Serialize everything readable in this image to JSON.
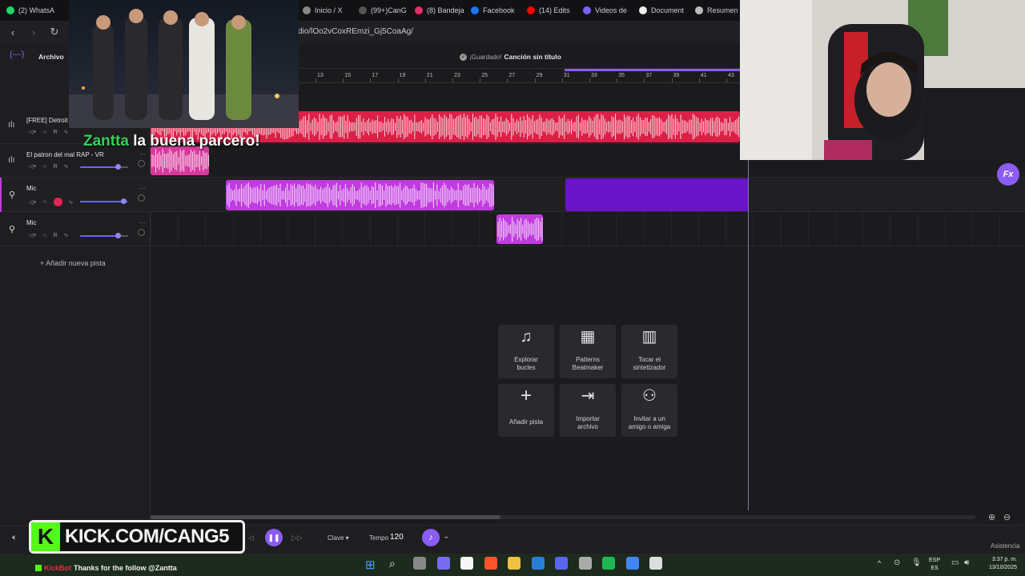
{
  "browser": {
    "tabs": [
      {
        "label": "(2) WhatsA",
        "color": "#25d366"
      },
      {
        "label": "Inicio / X",
        "color": "#888888"
      },
      {
        "label": "(99+)CanG",
        "color": "#555555"
      },
      {
        "label": "(8) Bandeja",
        "color": "#e1306c"
      },
      {
        "label": "Facebook",
        "color": "#1877f2"
      },
      {
        "label": "(14) Edits",
        "color": "#ff0000"
      },
      {
        "label": "Videos de",
        "color": "#7b61ff"
      },
      {
        "label": "Document",
        "color": "#f0f0f0"
      },
      {
        "label": "Resumen",
        "color": "#bbbbbb"
      }
    ],
    "url": "dio/lOo2vCoxREmzi_Gj5CoaAg/"
  },
  "app": {
    "menu_label": "Archivo",
    "saved_status": "¡Guardado!",
    "song_title": "Canción sin título",
    "fx_label": "Fx",
    "add_track_label": "Añadir nueva pista",
    "ruler_ticks": [
      "13",
      "15",
      "17",
      "19",
      "21",
      "23",
      "25",
      "27",
      "29",
      "31",
      "33",
      "35",
      "37",
      "39",
      "41",
      "43"
    ],
    "tracks": [
      {
        "name": "[FREE] Detroit",
        "rec": "R"
      },
      {
        "name": "El patron del mal RAP - VR",
        "rec": "R"
      },
      {
        "name": "Mic",
        "rec": ""
      },
      {
        "name": "Mic",
        "rec": "R"
      }
    ],
    "cards": [
      {
        "icon": "♫",
        "label": "Explorar bucles"
      },
      {
        "icon": "▦",
        "label": "Patterns Beatmaker"
      },
      {
        "icon": "▥",
        "label": "Tocar el sintetizador"
      },
      {
        "icon": "+",
        "label": "Añadir pista"
      },
      {
        "icon": "⇥",
        "label": "Importar archivo"
      },
      {
        "icon": "⚇",
        "label": "Invitar a un amigo o amiga"
      }
    ],
    "bottom": {
      "key_label": "Clave",
      "tempo_label": "Tempo",
      "tempo_value": "120"
    },
    "help_label": "Asistencia"
  },
  "overlay": {
    "caption_name": "Zantta",
    "caption_text": "la buena parcero!",
    "kick_letter": "K",
    "kick_text": "KICK.COM/CANG5",
    "follow_user": "KickBot",
    "follow_text": "Thanks for the follow @Zantta"
  },
  "taskbar": {
    "lang": "ESP",
    "lang2": "ES",
    "time": "3:37 p. m.",
    "date": "13/10/2025"
  },
  "colors": {
    "accent": "#8b5cf6",
    "red_clip": "#dc1f46",
    "pink_clip": "#d63a9c",
    "purple_clip": "#c13be0",
    "dark_purple_clip": "#6a14c9"
  }
}
